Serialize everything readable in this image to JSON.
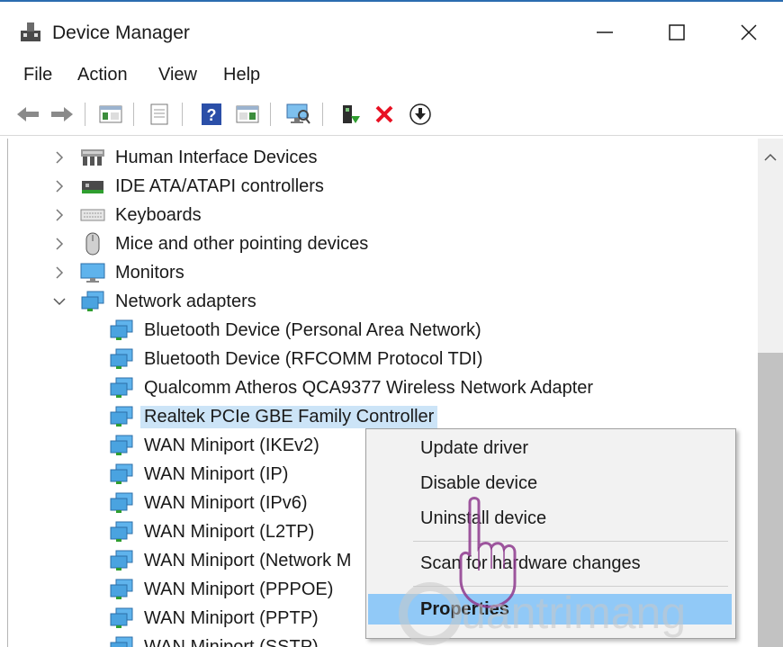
{
  "window": {
    "title": "Device Manager"
  },
  "menubar": {
    "items": [
      "File",
      "Action",
      "View",
      "Help"
    ]
  },
  "tree": {
    "categories": [
      "Human Interface Devices",
      "IDE ATA/ATAPI controllers",
      "Keyboards",
      "Mice and other pointing devices",
      "Monitors",
      "Network adapters"
    ],
    "network_adapters": [
      "Bluetooth Device (Personal Area Network)",
      "Bluetooth Device (RFCOMM Protocol TDI)",
      "Qualcomm Atheros QCA9377 Wireless Network Adapter",
      "Realtek PCIe GBE Family Controller",
      "WAN Miniport (IKEv2)",
      "WAN Miniport (IP)",
      "WAN Miniport (IPv6)",
      "WAN Miniport (L2TP)",
      "WAN Miniport (Network M",
      "WAN Miniport (PPPOE)",
      "WAN Miniport (PPTP)",
      "WAN Miniport (SSTP)"
    ],
    "selected": "Realtek PCIe GBE Family Controller"
  },
  "context_menu": {
    "items": [
      "Update driver",
      "Disable device",
      "Uninstall device",
      "Scan for hardware changes",
      "Properties"
    ],
    "highlighted": "Properties"
  },
  "watermark": {
    "text": "uantrimang"
  },
  "colors": {
    "selection": "#cce4f7",
    "menu_highlight": "#91c9f7",
    "accent_border": "#2b6cb0",
    "delete_red": "#e81123"
  }
}
